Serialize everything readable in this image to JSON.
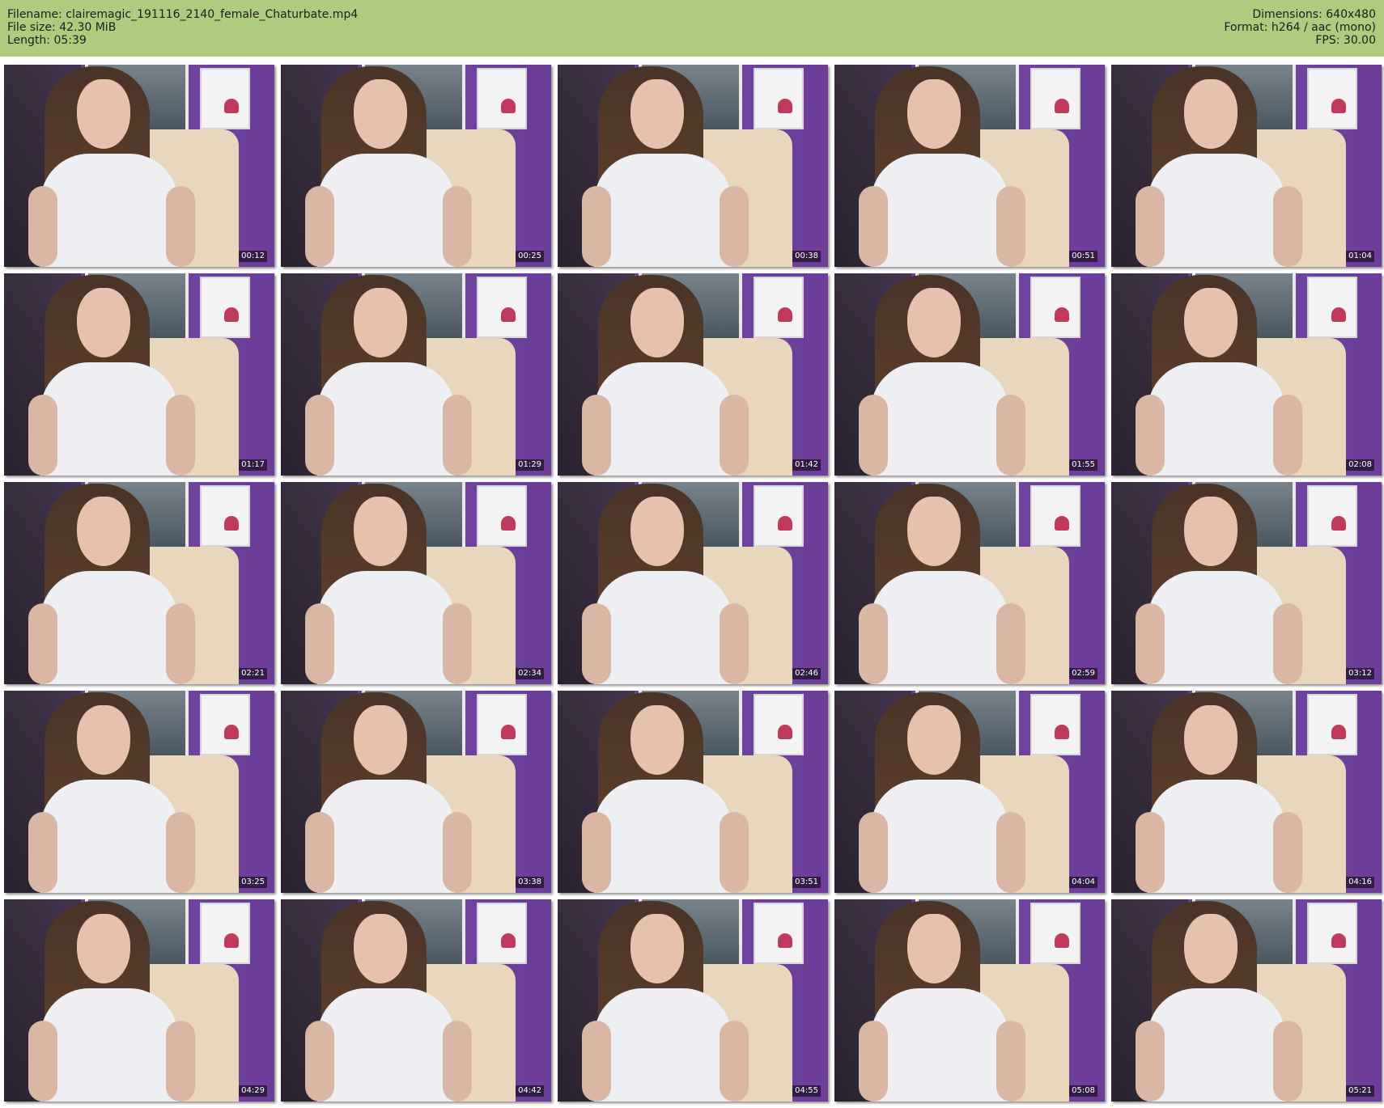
{
  "header": {
    "filename": "Filename: clairemagic_191116_2140_female_Chaturbate.mp4",
    "filesize": "File size: 42.30 MiB",
    "length": "Length: 05:39",
    "dimensions": "Dimensions: 640x480",
    "format": "Format: h264 / aac (mono)",
    "fps": "FPS: 30.00"
  },
  "colors": {
    "header_bg": "#adcc7e",
    "wall": "#6f44a0"
  },
  "thumbnails": [
    {
      "timestamp": "00:12"
    },
    {
      "timestamp": "00:25"
    },
    {
      "timestamp": "00:38"
    },
    {
      "timestamp": "00:51"
    },
    {
      "timestamp": "01:04"
    },
    {
      "timestamp": "01:17"
    },
    {
      "timestamp": "01:29"
    },
    {
      "timestamp": "01:42"
    },
    {
      "timestamp": "01:55"
    },
    {
      "timestamp": "02:08"
    },
    {
      "timestamp": "02:21"
    },
    {
      "timestamp": "02:34"
    },
    {
      "timestamp": "02:46"
    },
    {
      "timestamp": "02:59"
    },
    {
      "timestamp": "03:12"
    },
    {
      "timestamp": "03:25"
    },
    {
      "timestamp": "03:38"
    },
    {
      "timestamp": "03:51"
    },
    {
      "timestamp": "04:04"
    },
    {
      "timestamp": "04:16"
    },
    {
      "timestamp": "04:29"
    },
    {
      "timestamp": "04:42"
    },
    {
      "timestamp": "04:55"
    },
    {
      "timestamp": "05:08"
    },
    {
      "timestamp": "05:21"
    }
  ]
}
